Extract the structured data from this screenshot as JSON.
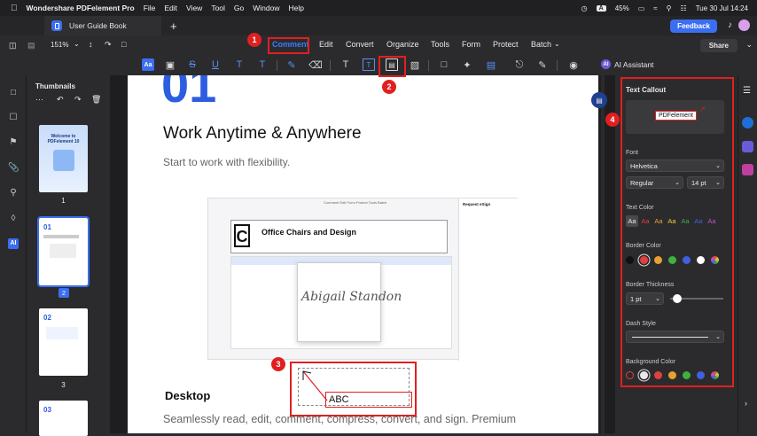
{
  "menubar": {
    "app_name": "Wondershare PDFelement Pro",
    "items": [
      "File",
      "Edit",
      "View",
      "Tool",
      "Go",
      "Window",
      "Help"
    ],
    "kbd": "A",
    "battery": "45%",
    "datetime": "Tue 30 Jul  14:24"
  },
  "tabbar": {
    "tab_title": "User Guide Book",
    "plus": "+",
    "feedback": "Feedback"
  },
  "toolbar": {
    "zoom": "151%",
    "menus": [
      "Comment",
      "Edit",
      "Convert",
      "Organize",
      "Tools",
      "Form",
      "Protect",
      "Batch"
    ],
    "share": "Share",
    "ai_assistant": "AI Assistant"
  },
  "thumbnails": {
    "title": "Thumbnails",
    "pages": [
      "1",
      "2",
      "3"
    ],
    "page1_text": "Welcome to PDFelement 10",
    "page2_text": "01",
    "page3_text": "02",
    "page4_text": "03"
  },
  "document": {
    "big_number": "01",
    "heading": "Work Anytime & Anywhere",
    "subheading": "Start to work with flexibility.",
    "section": "Desktop",
    "body": "Seamlessly read, edit, comment, compress, convert, and sign. Premium",
    "shot_title": "Office Chairs and Design",
    "shot_tabs": "Comment  Edit  Form  Protect  Tools  Batch",
    "shot_side_title": "Request eSign",
    "signature": "Abigail Standon",
    "callout_text": "ABC"
  },
  "panel": {
    "title": "Text Callout",
    "preview_text": "PDFelement",
    "font_label": "Font",
    "font_value": "Helvetica",
    "style_value": "Regular",
    "size_value": "14 pt",
    "text_color_label": "Text Color",
    "text_color_samples": [
      "Aa",
      "Aa",
      "Aa",
      "Aa",
      "Aa",
      "Aa",
      "Aa"
    ],
    "text_colors": [
      "#e8e8e8",
      "#e04040",
      "#e8a030",
      "#e8d040",
      "#40b040",
      "#4060e0",
      "#c050d0"
    ],
    "border_color_label": "Border Color",
    "border_colors": [
      "#111111",
      "#e04040",
      "#e8a030",
      "#40b040",
      "#4060e0",
      "#ffffff",
      "rainbow"
    ],
    "border_thickness_label": "Border Thickness",
    "thickness_value": "1 pt",
    "thickness_level": 0.05,
    "dash_style_label": "Dash Style",
    "background_color_label": "Background Color",
    "background_colors": [
      "none",
      "#e8e8e8",
      "#e04040",
      "#e8a030",
      "#40b040",
      "#4060e0",
      "rainbow"
    ]
  },
  "annotations": {
    "n1": "1",
    "n2": "2",
    "n3": "3",
    "n4": "4"
  }
}
